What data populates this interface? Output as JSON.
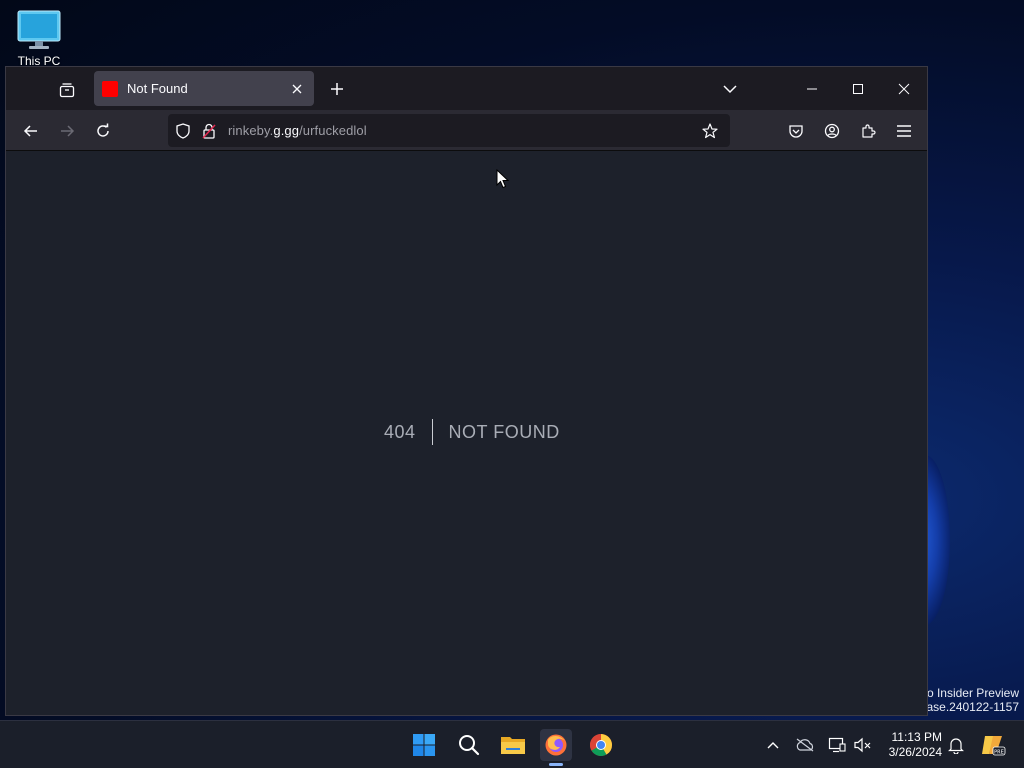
{
  "desktop": {
    "this_pc_label": "This PC",
    "watermark_line1": "ro Insider Preview",
    "watermark_line2": "ease.240122-1157"
  },
  "browser": {
    "tab": {
      "title": "Not Found",
      "favicon_color": "#ff0000"
    },
    "url": {
      "prefix": "rinkeby.",
      "host": "g.gg",
      "path": "/urfuckedlol"
    },
    "colors": {
      "tab_strip": "#1c1b22",
      "toolbar": "#2b2a33",
      "content_bg": "#1d212b"
    }
  },
  "page": {
    "error_code": "404",
    "error_message": "NOT FOUND"
  },
  "taskbar": {
    "apps": [
      "start-icon",
      "search-icon",
      "file-explorer-icon",
      "firefox-icon",
      "chrome-icon"
    ],
    "active_app": "firefox-icon",
    "clock_time": "11:13 PM",
    "clock_date": "3/26/2024"
  }
}
